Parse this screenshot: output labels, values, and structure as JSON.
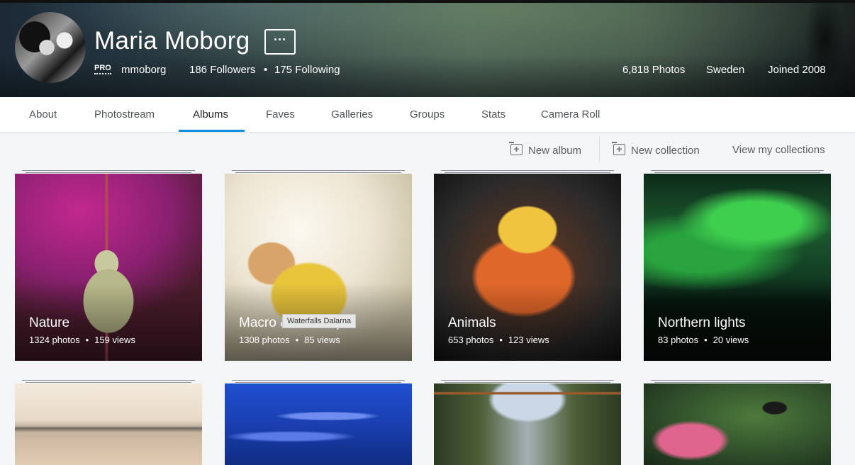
{
  "profile": {
    "name": "Maria Moborg",
    "more_label": "···",
    "pro_badge": "PRO",
    "username": "mmoborg",
    "followers": "186 Followers",
    "following": "175 Following",
    "separator": "•",
    "photos": "6,818 Photos",
    "location": "Sweden",
    "joined": "Joined 2008"
  },
  "tabs": [
    {
      "label": "About"
    },
    {
      "label": "Photostream"
    },
    {
      "label": "Albums",
      "active": true
    },
    {
      "label": "Faves"
    },
    {
      "label": "Galleries"
    },
    {
      "label": "Groups"
    },
    {
      "label": "Stats"
    },
    {
      "label": "Camera Roll"
    }
  ],
  "actions": {
    "new_album": "New album",
    "new_collection": "New collection",
    "view_collections": "View my collections"
  },
  "albums": [
    {
      "title": "Nature",
      "photos": "1324 photos",
      "views": "159 views"
    },
    {
      "title": "Macro & close-up",
      "photos": "1308 photos",
      "views": "85 views"
    },
    {
      "title": "Animals",
      "photos": "653 photos",
      "views": "123 views"
    },
    {
      "title": "Northern lights",
      "photos": "83 photos",
      "views": "20 views"
    },
    {
      "title": "",
      "photos": "",
      "views": ""
    },
    {
      "title": "",
      "photos": "",
      "views": ""
    },
    {
      "title": "",
      "photos": "",
      "views": ""
    },
    {
      "title": "",
      "photos": "",
      "views": ""
    }
  ],
  "stats_separator": "•",
  "tooltip": "Waterfalls Dalarna",
  "colors": {
    "accent": "#128fdc",
    "page_bg": "#f3f5f6"
  }
}
